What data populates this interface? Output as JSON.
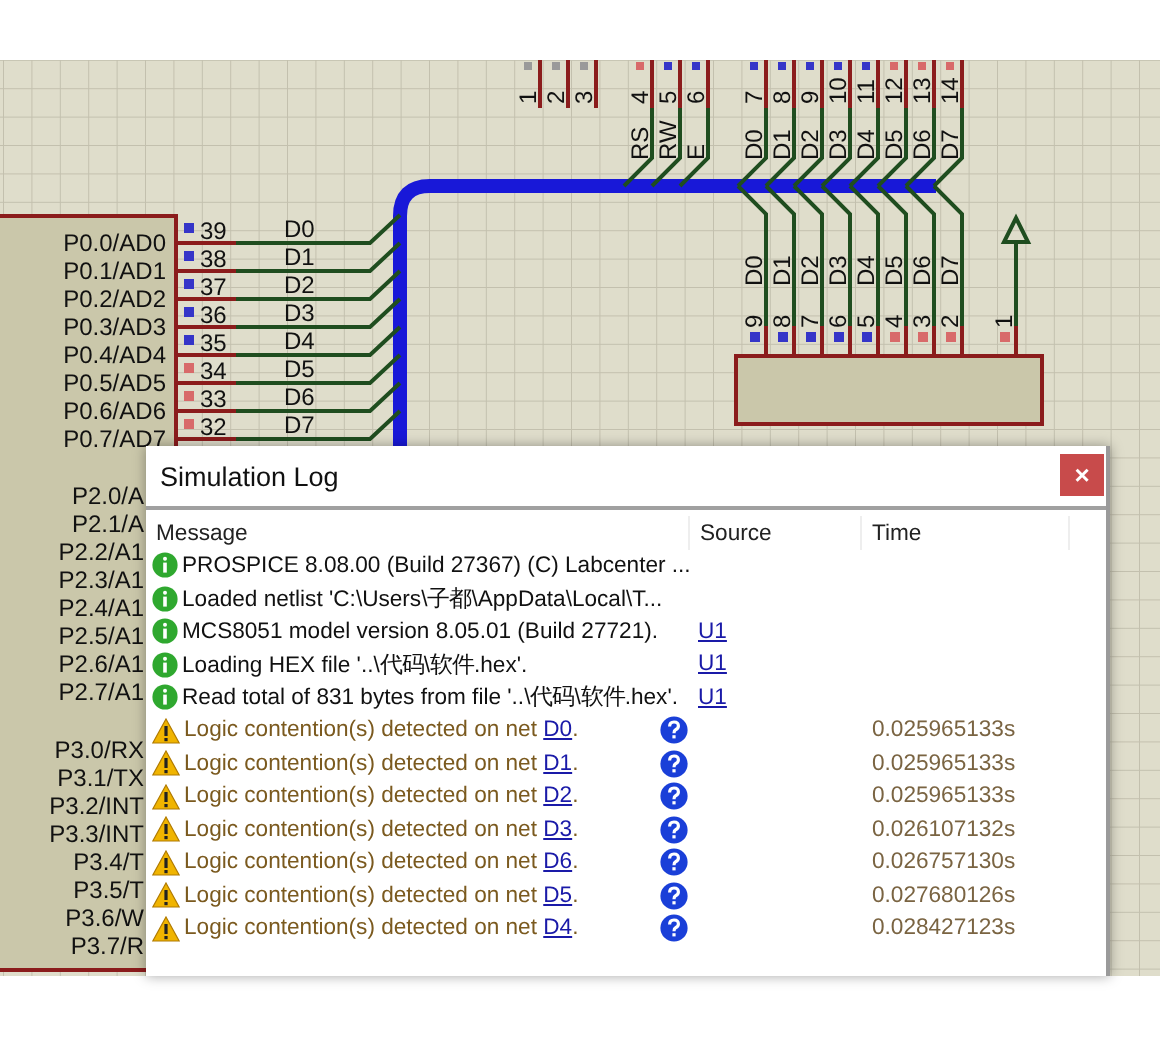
{
  "schematic": {
    "chip_pins": [
      {
        "label": "P0.0/AD0",
        "number": "39",
        "net": "D0",
        "color": "#3535c8"
      },
      {
        "label": "P0.1/AD1",
        "number": "38",
        "net": "D1",
        "color": "#3535c8"
      },
      {
        "label": "P0.2/AD2",
        "number": "37",
        "net": "D2",
        "color": "#3535c8"
      },
      {
        "label": "P0.3/AD3",
        "number": "36",
        "net": "D3",
        "color": "#3535c8"
      },
      {
        "label": "P0.4/AD4",
        "number": "35",
        "net": "D4",
        "color": "#3535c8"
      },
      {
        "label": "P0.5/AD5",
        "number": "34",
        "net": "D5",
        "color": "#d86a6a"
      },
      {
        "label": "P0.6/AD6",
        "number": "33",
        "net": "D6",
        "color": "#d86a6a"
      },
      {
        "label": "P0.7/AD7",
        "number": "32",
        "net": "D7",
        "color": "#d86a6a"
      }
    ],
    "port2_labels": [
      "P2.0/A",
      "P2.1/A",
      "P2.2/A1",
      "P2.3/A1",
      "P2.4/A1",
      "P2.5/A1",
      "P2.6/A1",
      "P2.7/A1"
    ],
    "port3_labels": [
      "P3.0/RX",
      "P3.1/TX",
      "P3.2/INT",
      "P3.3/INT",
      "P3.4/T",
      "P3.5/T",
      "P3.6/W",
      "P3.7/R"
    ],
    "lcd_pins": [
      {
        "number": "1",
        "color": "#9a9a9a"
      },
      {
        "number": "2",
        "color": "#9a9a9a"
      },
      {
        "number": "3",
        "color": "#9a9a9a"
      },
      {
        "number": "4",
        "color": "#d86a6a",
        "net": "RS"
      },
      {
        "number": "5",
        "color": "#3535c8",
        "net": "RW"
      },
      {
        "number": "6",
        "color": "#3535c8",
        "net": "E"
      },
      {
        "number": "7",
        "color": "#3535c8",
        "net": "D0"
      },
      {
        "number": "8",
        "color": "#3535c8",
        "net": "D1"
      },
      {
        "number": "9",
        "color": "#3535c8",
        "net": "D2"
      },
      {
        "number": "10",
        "color": "#3535c8",
        "net": "D3"
      },
      {
        "number": "11",
        "color": "#3535c8",
        "net": "D4"
      },
      {
        "number": "12",
        "color": "#d86a6a",
        "net": "D5"
      },
      {
        "number": "13",
        "color": "#d86a6a",
        "net": "D6"
      },
      {
        "number": "14",
        "color": "#d86a6a",
        "net": "D7"
      }
    ],
    "resistor_pins": [
      {
        "kind": "net",
        "number": "9",
        "color": "#3535c8",
        "net": "D0"
      },
      {
        "kind": "net",
        "number": "8",
        "color": "#3535c8",
        "net": "D1"
      },
      {
        "kind": "net",
        "number": "7",
        "color": "#3535c8",
        "net": "D2"
      },
      {
        "kind": "net",
        "number": "6",
        "color": "#3535c8",
        "net": "D3"
      },
      {
        "kind": "net",
        "number": "5",
        "color": "#3535c8",
        "net": "D4"
      },
      {
        "kind": "net",
        "number": "4",
        "color": "#d86a6a",
        "net": "D5"
      },
      {
        "kind": "net",
        "number": "3",
        "color": "#d86a6a",
        "net": "D6"
      },
      {
        "kind": "net",
        "number": "2",
        "color": "#d86a6a",
        "net": "D7"
      },
      {
        "kind": "supply",
        "number": "1",
        "color": "#d86a6a"
      }
    ]
  },
  "log": {
    "title": "Simulation Log",
    "close": "×",
    "columns": [
      "Message",
      "Source",
      "Time"
    ],
    "rows": [
      {
        "kind": "info",
        "message": "PROSPICE 8.08.00 (Build 27367) (C) Labcenter ..."
      },
      {
        "kind": "info",
        "message": "Loaded netlist 'C:\\Users\\子都\\AppData\\Local\\T..."
      },
      {
        "kind": "info",
        "message": "MCS8051 model version 8.05.01 (Build 27721).",
        "source": "U1"
      },
      {
        "kind": "info",
        "message": "Loading HEX file '..\\代码\\软件.hex'.",
        "source": "U1"
      },
      {
        "kind": "info",
        "message": "Read total of 831 bytes from file '..\\代码\\软件.hex'.",
        "source": "U1"
      },
      {
        "kind": "warning",
        "message": "Logic contention(s) detected on net ",
        "net": "D0",
        "end": ".",
        "time": "0.025965133s"
      },
      {
        "kind": "warning",
        "message": "Logic contention(s) detected on net ",
        "net": "D1",
        "end": ".",
        "time": "0.025965133s"
      },
      {
        "kind": "warning",
        "message": "Logic contention(s) detected on net ",
        "net": "D2",
        "end": ".",
        "time": "0.025965133s"
      },
      {
        "kind": "warning",
        "message": "Logic contention(s) detected on net ",
        "net": "D3",
        "end": ".",
        "time": "0.026107132s"
      },
      {
        "kind": "warning",
        "message": "Logic contention(s) detected on net ",
        "net": "D6",
        "end": ".",
        "time": "0.026757130s"
      },
      {
        "kind": "warning",
        "message": "Logic contention(s) detected on net ",
        "net": "D5",
        "end": ".",
        "time": "0.027680126s"
      },
      {
        "kind": "warning",
        "message": "Logic contention(s) detected on net ",
        "net": "D4",
        "end": ".",
        "time": "0.028427123s"
      }
    ]
  }
}
